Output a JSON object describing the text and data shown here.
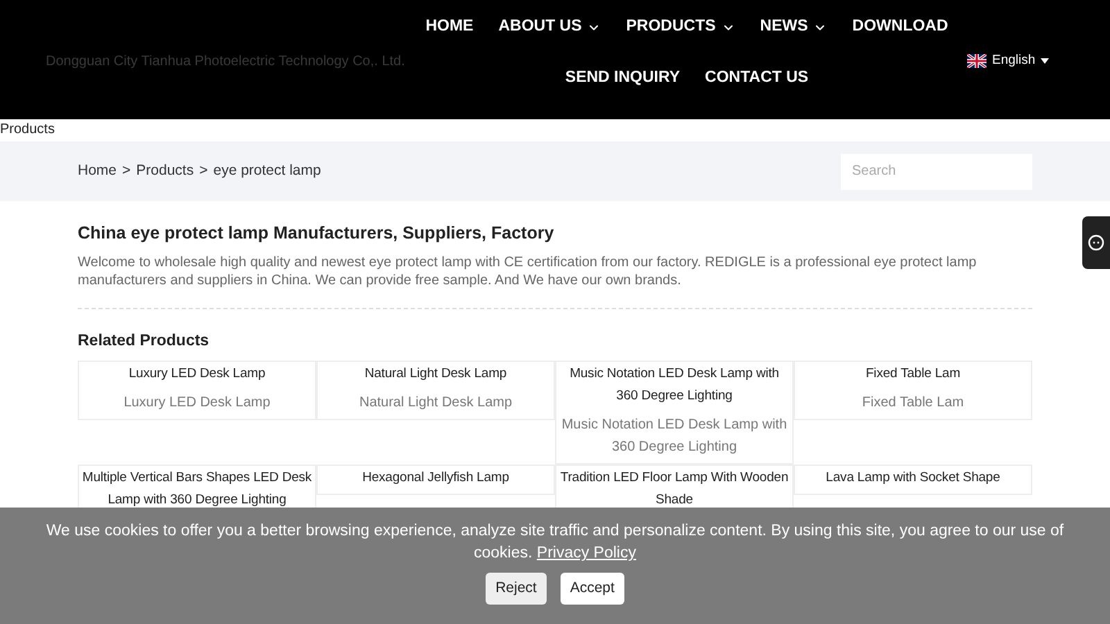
{
  "header": {
    "company": "Dongguan City Tianhua Photoelectric Technology Co,. Ltd.",
    "nav": [
      {
        "label": "HOME",
        "dropdown": false
      },
      {
        "label": "ABOUT US",
        "dropdown": true
      },
      {
        "label": "PRODUCTS",
        "dropdown": true
      },
      {
        "label": "NEWS",
        "dropdown": true
      },
      {
        "label": "DOWNLOAD",
        "dropdown": false
      },
      {
        "label": "SEND INQUIRY",
        "dropdown": false
      },
      {
        "label": "CONTACT US",
        "dropdown": false
      }
    ],
    "language": "English"
  },
  "page_label": "Products",
  "breadcrumb": [
    "Home",
    "Products",
    "eye protect lamp"
  ],
  "breadcrumb_separator": ">",
  "search": {
    "placeholder": "Search"
  },
  "title": "China eye protect lamp Manufacturers, Suppliers, Factory",
  "description": "Welcome to wholesale high quality and newest eye protect lamp with CE certification from our factory. REDIGLE is a professional eye protect lamp manufacturers and suppliers in China. We can provide free sample. And We have our own brands.",
  "related": {
    "heading": "Related Products",
    "rows": [
      [
        {
          "name": "Luxury LED Desk Lamp",
          "caption": "Luxury LED Desk Lamp"
        },
        {
          "name": "Natural Light Desk Lamp",
          "caption": "Natural Light Desk Lamp"
        },
        {
          "name": "Music Notation LED Desk Lamp with 360 Degree Lighting",
          "caption": "Music Notation LED Desk Lamp with 360 Degree Lighting"
        },
        {
          "name": "Fixed Table Lam",
          "caption": "Fixed Table Lam"
        }
      ],
      [
        {
          "name": "Multiple Vertical Bars Shapes LED Desk Lamp with 360 Degree Lighting"
        },
        {
          "name": "Hexagonal Jellyfish Lamp"
        },
        {
          "name": "Tradition LED Floor Lamp With Wooden Shade"
        },
        {
          "name": "Lava Lamp with Socket Shape"
        }
      ]
    ]
  },
  "cookie": {
    "text": "We use cookies to offer you a better browsing experience, analyze site traffic and personalize content. By using this site, you agree to our use of cookies.",
    "link": "Privacy Policy",
    "buttons": [
      "Reject",
      "Accept"
    ]
  }
}
